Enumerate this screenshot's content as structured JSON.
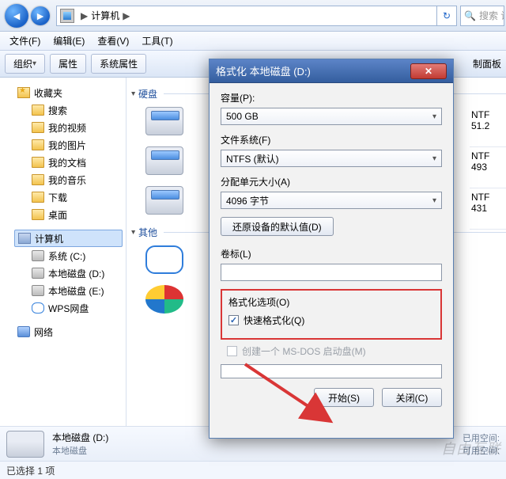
{
  "addressbar": {
    "location": "计算机",
    "sep": "▶",
    "search_placeholder": "搜索 计算"
  },
  "menubar": {
    "file": "文件(F)",
    "edit": "编辑(E)",
    "view": "查看(V)",
    "tools": "工具(T)"
  },
  "toolbar": {
    "organize": "组织",
    "properties": "属性",
    "sysprops": "系统属性",
    "right_partial": "制面板"
  },
  "tree": {
    "items": [
      {
        "label": "收藏夹",
        "icon": "ic-fav"
      },
      {
        "label": "搜索",
        "icon": "ic-fold",
        "indent": true
      },
      {
        "label": "我的视频",
        "icon": "ic-fold",
        "indent": true
      },
      {
        "label": "我的图片",
        "icon": "ic-fold",
        "indent": true
      },
      {
        "label": "我的文档",
        "icon": "ic-fold",
        "indent": true
      },
      {
        "label": "我的音乐",
        "icon": "ic-fold",
        "indent": true
      },
      {
        "label": "下载",
        "icon": "ic-fold",
        "indent": true
      },
      {
        "label": "桌面",
        "icon": "ic-fold",
        "indent": true
      }
    ],
    "computer": "计算机",
    "drives": [
      {
        "label": "系统 (C:)",
        "icon": "ic-drv"
      },
      {
        "label": "本地磁盘 (D:)",
        "icon": "ic-drv"
      },
      {
        "label": "本地磁盘 (E:)",
        "icon": "ic-drv"
      },
      {
        "label": "WPS网盘",
        "icon": "ic-cloud"
      }
    ],
    "network": "网络"
  },
  "content": {
    "group_hdd": "硬盘",
    "group_other": "其他",
    "drives": [
      {
        "name": ""
      },
      {
        "name": ""
      },
      {
        "name": ""
      }
    ],
    "right": [
      {
        "fs": "NTF",
        "size": "51.2"
      },
      {
        "fs": "NTF",
        "size": "493"
      },
      {
        "fs": "NTF",
        "size": "431"
      }
    ]
  },
  "details": {
    "name": "本地磁盘 (D:)",
    "type": "本地磁盘",
    "used_label": "已用空间:",
    "free_label": "可用空间:"
  },
  "status": {
    "text": "已选择 1 项"
  },
  "dialog": {
    "title": "格式化 本地磁盘 (D:)",
    "capacity_label": "容量(P):",
    "capacity_value": "500 GB",
    "filesystem_label": "文件系统(F)",
    "filesystem_value": "NTFS (默认)",
    "alloc_label": "分配单元大小(A)",
    "alloc_value": "4096 字节",
    "restore_btn": "还原设备的默认值(D)",
    "volume_label": "卷标(L)",
    "volume_value": "",
    "options_label": "格式化选项(O)",
    "quick_label": "快速格式化(Q)",
    "msdos_label": "创建一个 MS-DOS 启动盘(M)",
    "start_btn": "开始(S)",
    "close_btn": "关闭(C)"
  },
  "watermark": "自由互联"
}
